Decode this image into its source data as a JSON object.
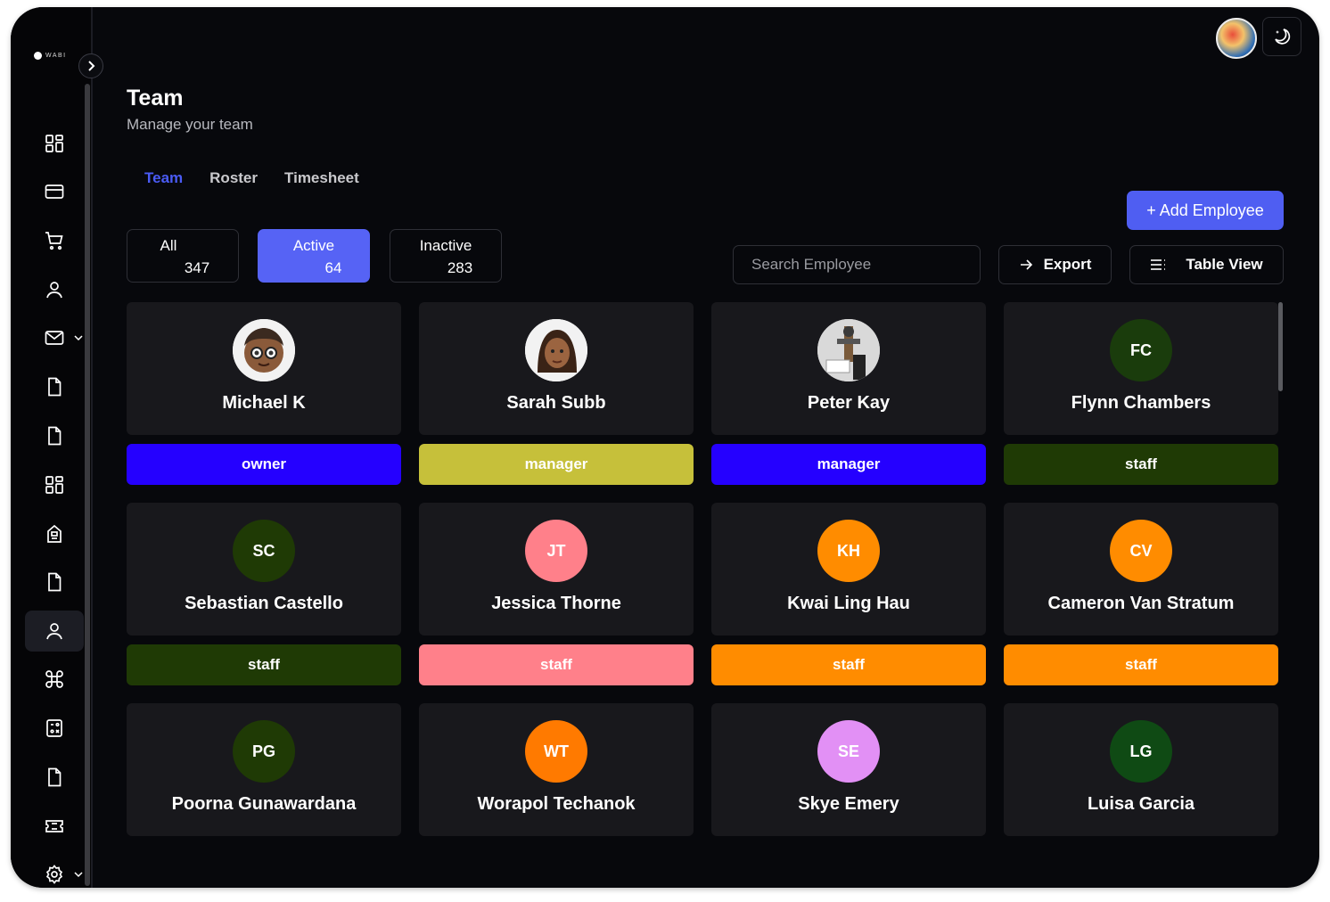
{
  "app": {
    "logo_text": "WABI"
  },
  "header": {
    "title": "Team",
    "subtitle": "Manage your team"
  },
  "tabs": [
    {
      "label": "Team",
      "active": true
    },
    {
      "label": "Roster",
      "active": false
    },
    {
      "label": "Timesheet",
      "active": false
    }
  ],
  "actions": {
    "add_employee": "+ Add Employee",
    "export": "Export",
    "table_view": "Table View"
  },
  "search": {
    "placeholder": "Search Employee",
    "value": ""
  },
  "filters": [
    {
      "label": "All",
      "count": "347",
      "active": false
    },
    {
      "label": "Active",
      "count": "64",
      "active": true
    },
    {
      "label": "Inactive",
      "count": "283",
      "active": false
    }
  ],
  "sidebar": {
    "items": [
      {
        "icon": "dashboard-grid-icon"
      },
      {
        "icon": "credit-card-icon"
      },
      {
        "icon": "cart-icon"
      },
      {
        "icon": "user-icon"
      },
      {
        "icon": "mail-icon",
        "has_caret": true
      },
      {
        "icon": "document-icon"
      },
      {
        "icon": "document-icon"
      },
      {
        "icon": "apps-grid-icon"
      },
      {
        "icon": "building-icon"
      },
      {
        "icon": "document-icon"
      },
      {
        "icon": "user-icon",
        "active": true
      },
      {
        "icon": "command-icon"
      },
      {
        "icon": "calculator-icon"
      },
      {
        "icon": "document-icon"
      },
      {
        "icon": "ticket-icon"
      },
      {
        "icon": "gear-icon",
        "has_caret": true
      }
    ]
  },
  "employees": [
    {
      "name": "Michael K",
      "initials": "",
      "avatar": "photo-memoji-man",
      "avatar_color": "#f2f2f2",
      "role": "owner",
      "role_color": "#2500ff"
    },
    {
      "name": "Sarah Subb",
      "initials": "",
      "avatar": "photo-memoji-woman",
      "avatar_color": "#f2f2f2",
      "role": "manager",
      "role_color": "#c6c03a"
    },
    {
      "name": "Peter Kay",
      "initials": "",
      "avatar": "photo-person",
      "avatar_color": "#dcdcdc",
      "role": "manager",
      "role_color": "#2500ff"
    },
    {
      "name": "Flynn Chambers",
      "initials": "FC",
      "avatar": "initials",
      "avatar_color": "#1a3c0c",
      "role": "staff",
      "role_color": "#1f3a05"
    },
    {
      "name": "Sebastian Castello",
      "initials": "SC",
      "avatar": "initials",
      "avatar_color": "#1f3a05",
      "role": "staff",
      "role_color": "#1f3a05"
    },
    {
      "name": "Jessica Thorne",
      "initials": "JT",
      "avatar": "initials",
      "avatar_color": "#ff808a",
      "role": "staff",
      "role_color": "#ff808a"
    },
    {
      "name": "Kwai Ling Hau",
      "initials": "KH",
      "avatar": "initials",
      "avatar_color": "#ff8c00",
      "role": "staff",
      "role_color": "#ff8c00"
    },
    {
      "name": "Cameron Van Stratum",
      "initials": "CV",
      "avatar": "initials",
      "avatar_color": "#ff8c00",
      "role": "staff",
      "role_color": "#ff8c00"
    },
    {
      "name": "Poorna Gunawardana",
      "initials": "PG",
      "avatar": "initials",
      "avatar_color": "#1f3a05",
      "role": "",
      "role_color": ""
    },
    {
      "name": "Worapol Techanok",
      "initials": "WT",
      "avatar": "initials",
      "avatar_color": "#ff7a00",
      "role": "",
      "role_color": ""
    },
    {
      "name": "Skye Emery",
      "initials": "SE",
      "avatar": "initials",
      "avatar_color": "#e290f5",
      "role": "",
      "role_color": ""
    },
    {
      "name": "Luisa Garcia",
      "initials": "LG",
      "avatar": "initials",
      "avatar_color": "#0f4a14",
      "role": "",
      "role_color": ""
    }
  ],
  "colors": {
    "accent": "#4f5ef2",
    "background": "#07080c",
    "card": "#18181c"
  }
}
